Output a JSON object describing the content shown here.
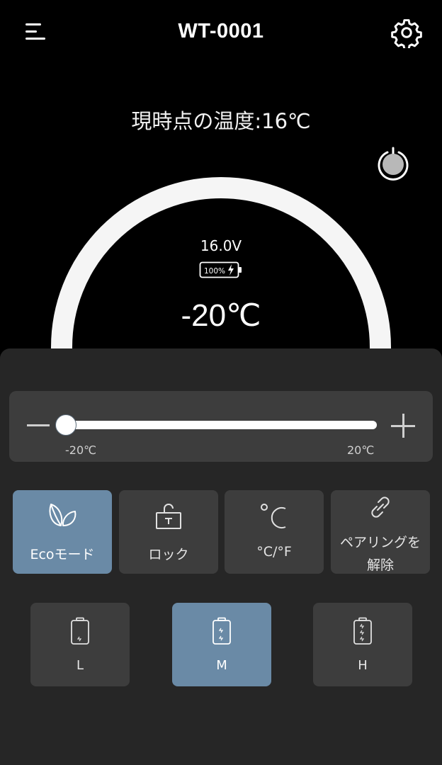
{
  "header": {
    "title": "WT-0001",
    "menu_icon": "menu-icon",
    "settings_icon": "gear-icon"
  },
  "status": {
    "current_temp": "現時点の温度:16℃",
    "voltage": "16.0V",
    "battery_percent": "100%",
    "set_temp": "-20℃"
  },
  "slider": {
    "min_label": "-20℃",
    "max_label": "20℃",
    "value": -20,
    "min": -20,
    "max": 20
  },
  "modes": [
    {
      "label": "Ecoモード",
      "icon": "leaf-icon",
      "active": true
    },
    {
      "label": "ロック",
      "icon": "lock-icon",
      "active": false
    },
    {
      "label": "°C/°F",
      "icon": "celsius-icon",
      "active": false
    },
    {
      "label": "ペアリングを解除",
      "label_line1": "ペアリングを",
      "label_line2": "解除",
      "icon": "unlink-icon",
      "active": false
    }
  ],
  "levels": [
    {
      "label": "L",
      "active": false
    },
    {
      "label": "M",
      "active": true
    },
    {
      "label": "H",
      "active": false
    }
  ],
  "colors": {
    "background": "#000000",
    "panel": "#262626",
    "card": "#3d3d3d",
    "accent": "#6a8aa6",
    "ring": "#f5f5f5"
  }
}
